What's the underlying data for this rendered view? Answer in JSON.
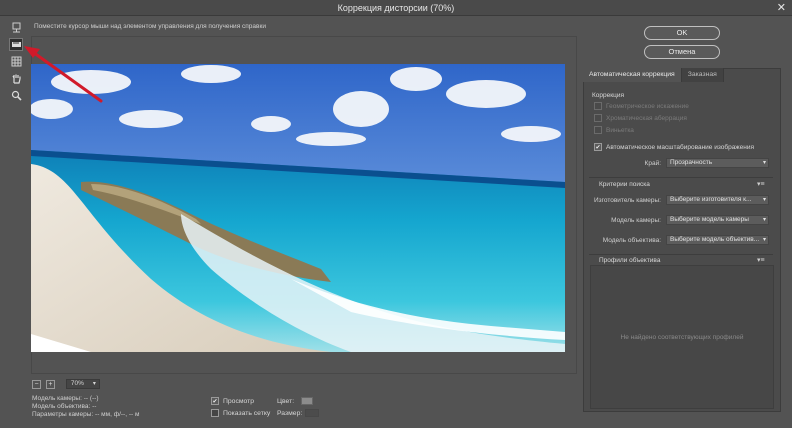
{
  "window": {
    "title": "Коррекция дисторсии (70%)",
    "close_label": "✕"
  },
  "tools": [
    {
      "name": "remove-distortion-tool-icon"
    },
    {
      "name": "straighten-tool-icon"
    },
    {
      "name": "move-grid-tool-icon"
    },
    {
      "name": "hand-tool-icon"
    },
    {
      "name": "zoom-tool-icon"
    }
  ],
  "hint": "Поместите курсор мыши над элементом управления для получения справки",
  "buttons": {
    "ok": "OK",
    "cancel": "Отмена"
  },
  "zoom": {
    "minus": "−",
    "plus": "+",
    "value": "70%"
  },
  "info": {
    "camera_model": "Модель камеры: -- (--)",
    "lens_model": "Модель объектива: --",
    "camera_params": "Параметры камеры: -- мм, ф/--, -- м"
  },
  "bottom": {
    "preview_label": "Просмотр",
    "show_grid_label": "Показать сетку",
    "color_label": "Цвет:",
    "size_label": "Размер:"
  },
  "tabs": {
    "auto": "Автоматическая коррекция",
    "custom": "Заказная"
  },
  "correction": {
    "title": "Коррекция",
    "geometric": "Геометрическое искажение",
    "chromatic": "Хроматическая аберрация",
    "vignette": "Виньетка",
    "auto_scale": "Автоматическое масштабирование изображения",
    "edge_label": "Край:",
    "edge_value": "Прозрачность"
  },
  "search": {
    "title": "Критерии поиска",
    "camera_maker_label": "Изготовитель камеры:",
    "camera_maker_value": "Выберите изготовителя к...",
    "camera_model_label": "Модель камеры:",
    "camera_model_value": "Выберите модель камеры",
    "lens_model_label": "Модель объектива:",
    "lens_model_value": "Выберите модель объектив..."
  },
  "profiles": {
    "title": "Профили объектива",
    "empty": "Не найдено соответствующих профилей"
  },
  "colors": {
    "annotation_arrow": "#d11a2a",
    "grid_swatch": "#8c8c8c"
  }
}
